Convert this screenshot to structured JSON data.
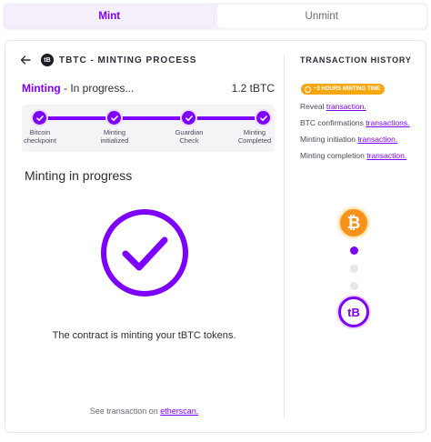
{
  "tabs": [
    {
      "label": "Mint",
      "active": true
    },
    {
      "label": "Unmint",
      "active": false
    }
  ],
  "header": {
    "logo_text": "tB",
    "title": "TBTC - MINTING PROCESS"
  },
  "status": {
    "strong": "Minting",
    "rest": " - In progress...",
    "amount": "1.2 tBTC"
  },
  "steps": [
    {
      "line1": "Bitcoin",
      "line2": "checkpoint",
      "done": true
    },
    {
      "line1": "Minting",
      "line2": "initialized",
      "done": true
    },
    {
      "line1": "Guardian",
      "line2": "Check",
      "done": true
    },
    {
      "line1": "Minting",
      "line2": "Completed",
      "done": true
    }
  ],
  "progress": {
    "heading": "Minting in progress",
    "message": "The contract is minting your tBTC tokens.",
    "see_prefix": "See transaction on ",
    "see_link": "etherscan."
  },
  "history": {
    "title": "TRANSACTION HISTORY",
    "badge": "~3 HOURS MINTING TIME",
    "items": [
      {
        "prefix": "Reveal ",
        "link": "transaction."
      },
      {
        "prefix": "BTC confirmations ",
        "link": "transactions."
      },
      {
        "prefix": "Minting initiation ",
        "link": "transaction."
      },
      {
        "prefix": "Minting completion ",
        "link": "transaction."
      }
    ],
    "btc_symbol": "₿",
    "tbtc_symbol": "tB"
  },
  "colors": {
    "accent": "#7d00ff",
    "bitcoin": "#f7931a",
    "badge": "#f7a70f",
    "inactive_dot": "#e6e6ec"
  }
}
